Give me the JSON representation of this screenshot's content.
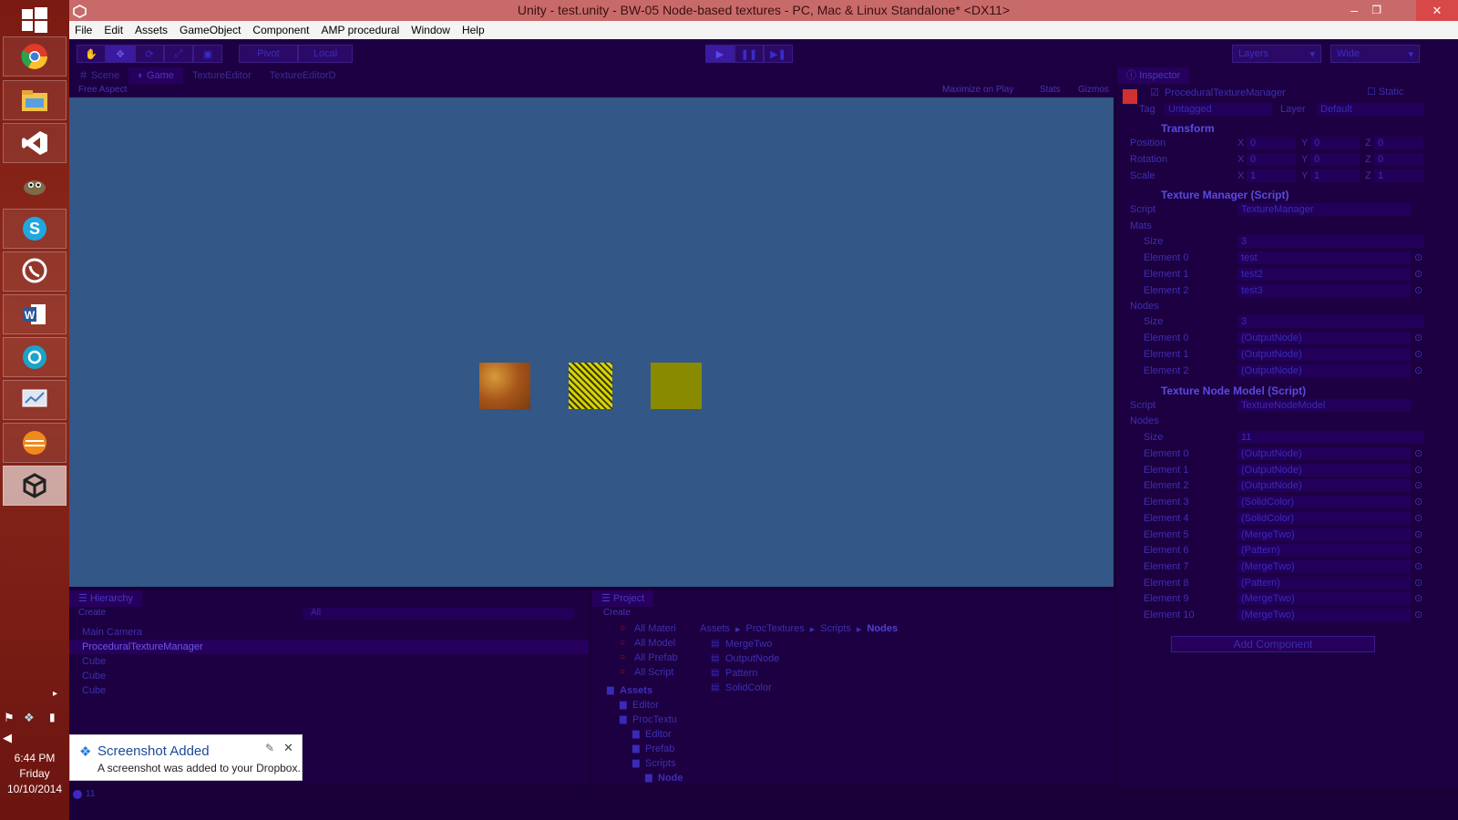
{
  "taskbar": {
    "icons": [
      "chrome-icon",
      "file-explorer-icon",
      "visual-studio-icon",
      "gimp-icon",
      "skype-icon",
      "viber-icon",
      "word-icon",
      "app-icon",
      "presentation-icon",
      "vlc-icon",
      "unity-icon"
    ],
    "clock": {
      "time": "6:44 PM",
      "day": "Friday",
      "date": "10/10/2014"
    }
  },
  "title": "Unity - test.unity - BW-05 Node-based textures - PC, Mac & Linux Standalone* <DX11>",
  "menu": [
    "File",
    "Edit",
    "Assets",
    "GameObject",
    "Component",
    "AMP procedural",
    "Window",
    "Help"
  ],
  "toolbar": {
    "pivot": "Pivot",
    "local": "Local",
    "layers": "Layers",
    "layout": "Wide"
  },
  "view_tabs": [
    "Scene",
    "Game",
    "TextureEditor",
    "TextureEditorD"
  ],
  "game_bar": {
    "aspect": "Free Aspect",
    "maximize": "Maximize on Play",
    "stats": "Stats",
    "gizmos": "Gizmos"
  },
  "inspector": {
    "tab": "Inspector",
    "object": "ProceduralTextureManager",
    "static": "Static",
    "tag_label": "Tag",
    "tag": "Untagged",
    "layer_label": "Layer",
    "layer": "Default",
    "transform": {
      "title": "Transform",
      "rows": [
        {
          "label": "Position",
          "x": "0",
          "y": "0",
          "z": "0"
        },
        {
          "label": "Rotation",
          "x": "0",
          "y": "0",
          "z": "0"
        },
        {
          "label": "Scale",
          "x": "1",
          "y": "1",
          "z": "1"
        }
      ]
    },
    "texture_manager": {
      "title": "Texture Manager (Script)",
      "script_label": "Script",
      "script": "TextureManager",
      "mats_label": "Mats",
      "mats_size": "3",
      "mats": [
        "test",
        "test2",
        "test3"
      ],
      "nodes_label": "Nodes",
      "nodes_size": "3",
      "nodes": [
        "(OutputNode)",
        "(OutputNode)",
        "(OutputNode)"
      ]
    },
    "node_model": {
      "title": "Texture Node Model (Script)",
      "script_label": "Script",
      "script": "TextureNodeModel",
      "nodes_label": "Nodes",
      "nodes_size": "11",
      "nodes": [
        "(OutputNode)",
        "(OutputNode)",
        "(OutputNode)",
        "(SolidColor)",
        "(SolidColor)",
        "(MergeTwo)",
        "(Pattern)",
        "(MergeTwo)",
        "(Pattern)",
        "(MergeTwo)",
        "(MergeTwo)"
      ]
    },
    "add_component": "Add Component",
    "size_label": "Size"
  },
  "hierarchy": {
    "tab": "Hierarchy",
    "create": "Create",
    "search": "All",
    "items": [
      "Main Camera",
      "ProceduralTextureManager",
      "Cube",
      "Cube",
      "Cube"
    ]
  },
  "project": {
    "tab": "Project",
    "create": "Create",
    "favorites": [
      "All Materi",
      "All Model",
      "All Prefab",
      "All Script"
    ],
    "tree": [
      "Assets",
      "Editor",
      "ProcTextu",
      "Editor",
      "Prefab",
      "Scripts",
      "Node"
    ],
    "breadcrumb": [
      "Assets",
      "ProcTextures",
      "Scripts",
      "Nodes"
    ],
    "files": [
      "MergeTwo",
      "OutputNode",
      "Pattern",
      "SolidColor"
    ]
  },
  "toast": {
    "title": "Screenshot Added",
    "body": "A screenshot was added to your Dropbox."
  },
  "status": {
    "count": "11"
  },
  "colors": {
    "game_bg": "#335786",
    "accent": "#4a38c4"
  }
}
